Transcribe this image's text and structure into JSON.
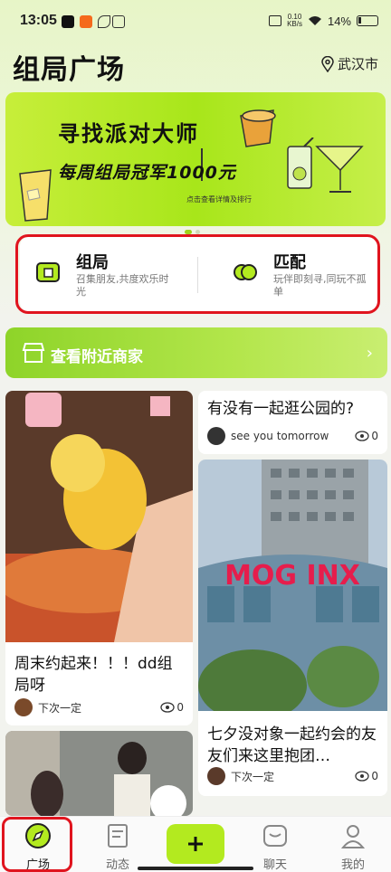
{
  "status_bar": {
    "time": "13:05",
    "net_speed": "0.10",
    "net_unit": "KB/s",
    "battery": "14%"
  },
  "header": {
    "title": "组局广场",
    "city": "武汉市"
  },
  "banner": {
    "headline": "寻找派对大师",
    "subtitle": "每周组局冠军1000元",
    "hint": "点击查看详情及排行"
  },
  "features": [
    {
      "title": "组局",
      "desc": "召集朋友,共度欢乐时光",
      "icon": "group-icon"
    },
    {
      "title": "匹配",
      "desc": "玩伴即刻寻,同玩不孤单",
      "icon": "match-icon"
    }
  ],
  "nearby": {
    "label": "查看附近商家"
  },
  "feed": {
    "left": [
      {
        "caption": "周末约起来！！！dd组局呀",
        "user": "下次一定",
        "views": "0"
      },
      {
        "caption": "",
        "user": "",
        "views": ""
      }
    ],
    "right": [
      {
        "caption": "有没有一起逛公园的?",
        "user": "see you tomorrow",
        "views": "0"
      },
      {
        "caption": "七夕没对象一起约会的友友们来这里抱团…",
        "user": "下次一定",
        "views": "0"
      }
    ],
    "sign_text": "MOG INX"
  },
  "nav": [
    {
      "label": "广场",
      "icon": "compass-icon"
    },
    {
      "label": "动态",
      "icon": "feed-icon"
    },
    {
      "label": "",
      "icon": "plus-icon"
    },
    {
      "label": "聊天",
      "icon": "chat-icon"
    },
    {
      "label": "我的",
      "icon": "profile-icon"
    }
  ],
  "colors": {
    "accent": "#b3ea1f",
    "highlight": "#e0141e",
    "nearby": "#8ed429"
  }
}
